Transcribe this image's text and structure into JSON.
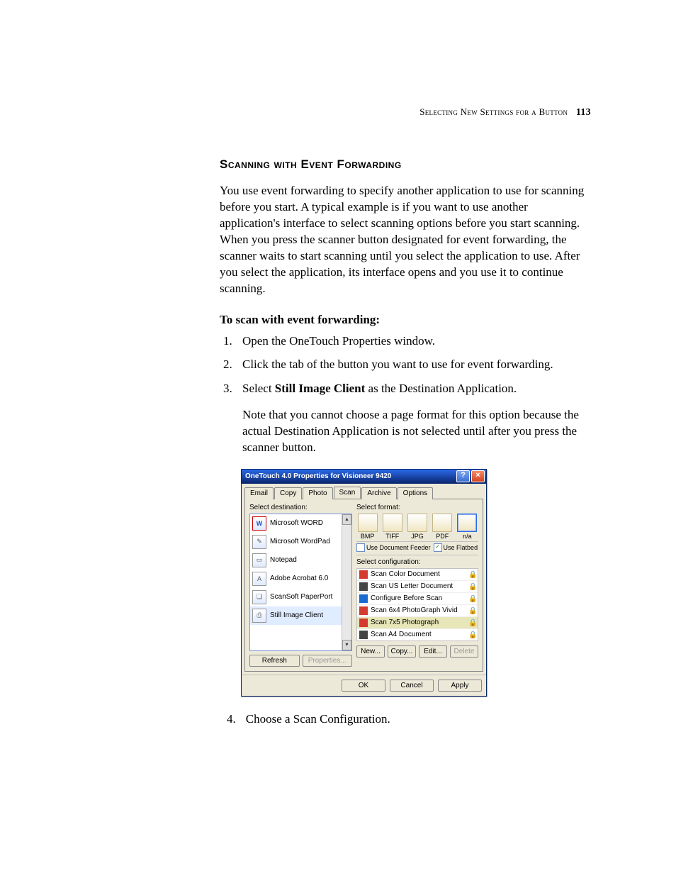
{
  "header": {
    "section_title": "Selecting New Settings for a Button",
    "page_number": "113"
  },
  "section_heading": "Scanning with Event Forwarding",
  "intro_paragraph": "You use event forwarding to specify another application to use for scanning before you start. A typical example is if you want to use another application's interface to select scanning options before you start scanning. When you press the scanner button designated for event forwarding, the scanner waits to start scanning until you select the application to use. After you select the application, its interface opens and you use it to continue scanning.",
  "procedure_heading": "To scan with event forwarding:",
  "steps": {
    "s1": "Open the OneTouch Properties window.",
    "s2": "Click the tab of the button you want to use for event forwarding.",
    "s3_pre": "Select ",
    "s3_bold": "Still Image Client",
    "s3_post": " as the Destination Application.",
    "s3_note": "Note that you cannot choose a page format for this option because the actual Destination Application is not selected until after you press the scanner button.",
    "s4": "Choose a Scan Configuration."
  },
  "dialog": {
    "title": "OneTouch 4.0 Properties for Visioneer 9420",
    "tabs": [
      "Email",
      "Copy",
      "Photo",
      "Scan",
      "Archive",
      "Options"
    ],
    "active_tab_index": 3,
    "left": {
      "label": "Select destination:",
      "items": [
        {
          "name": "Microsoft WORD",
          "icon": "W"
        },
        {
          "name": "Microsoft WordPad",
          "icon": "✎"
        },
        {
          "name": "Notepad",
          "icon": "▭"
        },
        {
          "name": "Adobe Acrobat 6.0",
          "icon": "A"
        },
        {
          "name": "ScanSoft PaperPort",
          "icon": "❏"
        },
        {
          "name": "Still Image Client",
          "icon": "⎙"
        }
      ],
      "selected_index": 5,
      "buttons": {
        "refresh": "Refresh",
        "properties": "Properties..."
      }
    },
    "right": {
      "format_label": "Select format:",
      "formats": [
        "BMP",
        "TIFF",
        "JPG",
        "PDF",
        "n/a"
      ],
      "format_selected_index": 4,
      "checks": {
        "feeder": "Use Document Feeder",
        "flatbed": "Use Flatbed",
        "feeder_checked": false,
        "flatbed_checked": true
      },
      "config_label": "Select configuration:",
      "configs": [
        {
          "name": "Scan Color Document",
          "color": "#d43a2f"
        },
        {
          "name": "Scan US Letter Document",
          "color": "#444"
        },
        {
          "name": "Configure Before Scan",
          "color": "#1a6ad0"
        },
        {
          "name": "Scan 6x4 PhotoGraph Vivid",
          "color": "#d43a2f"
        },
        {
          "name": "Scan 7x5 Photograph",
          "color": "#d43a2f"
        },
        {
          "name": "Scan A4 Document",
          "color": "#444"
        }
      ],
      "config_selected_index": 4,
      "action_buttons": {
        "new": "New...",
        "copy": "Copy...",
        "edit": "Edit...",
        "delete": "Delete"
      }
    },
    "footer": {
      "ok": "OK",
      "cancel": "Cancel",
      "apply": "Apply"
    }
  }
}
